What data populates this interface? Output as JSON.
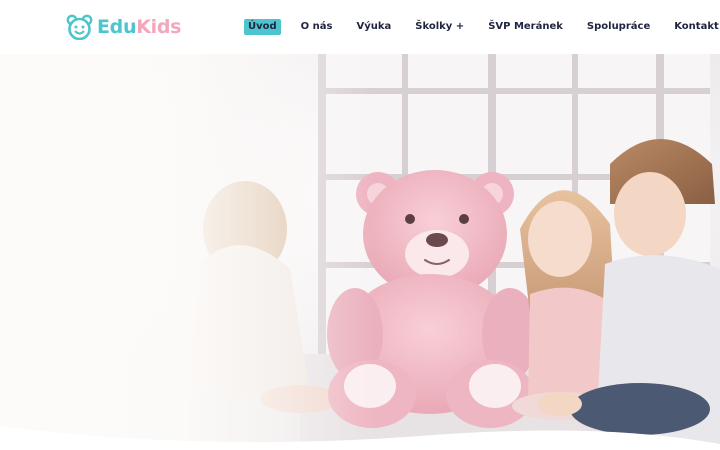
{
  "brand": {
    "part1": "Edu",
    "part2": "Kids",
    "colors": {
      "primary": "#4cc5cf",
      "secondary": "#f2a7bd",
      "text": "#1f2440"
    }
  },
  "nav": {
    "items": [
      {
        "label": "Úvod",
        "active": true
      },
      {
        "label": "O nás"
      },
      {
        "label": "Výuka"
      },
      {
        "label": "Školky +"
      },
      {
        "label": "ŠVP Meránek"
      },
      {
        "label": "Spolupráce"
      },
      {
        "label": "Kontakt"
      }
    ]
  },
  "hero": {
    "image": "children-with-pink-teddy-bear-by-window"
  }
}
